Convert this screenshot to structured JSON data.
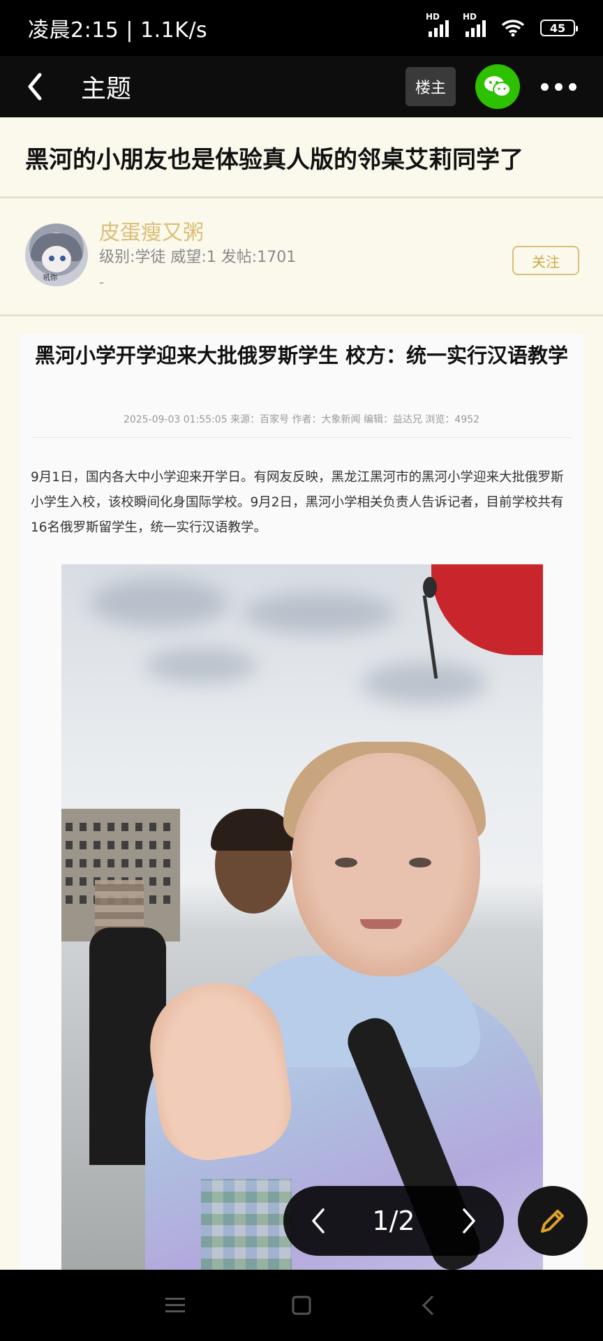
{
  "status_bar": {
    "time": "凌晨2:15",
    "net_speed": "1.1K/s",
    "signal_label": "HD",
    "battery": "45"
  },
  "app_bar": {
    "title": "主题",
    "louzhu_label": "楼主"
  },
  "post": {
    "title": "黑河的小朋友也是体验真人版的邻桌艾莉同学了"
  },
  "author": {
    "name": "皮蛋瘦又粥",
    "meta": "级别:学徒 威望:1 发帖:1701",
    "sub": "-",
    "follow_label": "关注",
    "avatar_tag": "吼你"
  },
  "article": {
    "headline": "黑河小学开学迎来大批俄罗斯学生 校方：统一实行汉语教学",
    "info": "2025-09-03 01:55:05 来源：百家号 作者：大象新闻 编辑：益达兄   浏览：4952",
    "paragraph": "9月1日，国内各大中小学迎来开学日。有网友反映，黑龙江黑河市的黑河小学迎来大批俄罗斯小学生入校，该校瞬间化身国际学校。9月2日，黑河小学相关负责人告诉记者，目前学校共有16名俄罗斯留学生，统一实行汉语教学。"
  },
  "pager": {
    "count": "1/2"
  },
  "colors": {
    "accent_gold": "#d9c078",
    "wechat_green": "#2dc100",
    "page_bg": "#fbf8ec"
  },
  "icons": {
    "back": "back-chevron-icon",
    "share": "wechat-icon",
    "more": "more-dots-icon",
    "edit": "pencil-icon",
    "prev": "chevron-left-icon",
    "next": "chevron-right-icon"
  }
}
